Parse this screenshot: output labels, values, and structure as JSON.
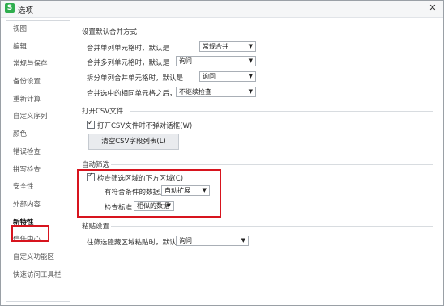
{
  "window": {
    "title": "选项",
    "app_icon_letter": "S",
    "close_glyph": "✕"
  },
  "sidebar": {
    "items": [
      {
        "label": "视图"
      },
      {
        "label": "编辑"
      },
      {
        "label": "常规与保存"
      },
      {
        "label": "备份设置"
      },
      {
        "label": "重新计算"
      },
      {
        "label": "自定义序列"
      },
      {
        "label": "颜色"
      },
      {
        "label": "错误检查"
      },
      {
        "label": "拼写检查"
      },
      {
        "label": "安全性"
      },
      {
        "label": "外部内容"
      },
      {
        "label": "新特性"
      },
      {
        "label": "信任中心"
      },
      {
        "label": "自定义功能区"
      },
      {
        "label": "快速访问工具栏"
      }
    ],
    "active_index": 11
  },
  "merge": {
    "title": "设置默认合并方式",
    "rows": [
      {
        "label": "合并单列单元格时，默认是",
        "value": "常规合并"
      },
      {
        "label": "合并多列单元格时，默认是",
        "value": "询问"
      },
      {
        "label": "拆分单列合并单元格时，默认是",
        "value": "询问"
      },
      {
        "label": "合并选中的相同单元格之后，",
        "value": "不继续检查"
      }
    ]
  },
  "csv": {
    "title": "打开CSV文件",
    "checkbox_label": "打开CSV文件时不弹对话框(W)",
    "checked": true,
    "clear_button": "清空CSV字段列表(L)"
  },
  "autofilter": {
    "title": "自动筛选",
    "checkbox_label": "检查筛选区域的下方区域(C)",
    "checked": true,
    "matching_label": "有符合条件的数据，则",
    "matching_value": "自动扩展",
    "criteria_label": "检查标准",
    "criteria_value": "相似的数据"
  },
  "paste": {
    "title": "粘贴设置",
    "row_label": "往筛选隐藏区域粘贴时，默认是",
    "row_value": "询问"
  },
  "icons": {
    "dropdown": "▼",
    "check": "✓"
  },
  "colors": {
    "highlight": "#d7141e",
    "app_icon": "#2fae4e"
  }
}
